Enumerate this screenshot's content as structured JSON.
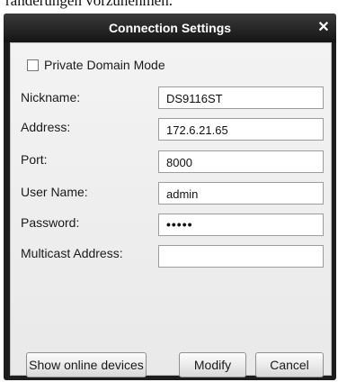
{
  "background": {
    "text": "ränderungen vorzunehmen."
  },
  "dialog": {
    "title": "Connection Settings",
    "close_glyph": "✕",
    "private_domain": {
      "label": "Private Domain Mode",
      "checked": false
    },
    "fields": [
      {
        "label": "Nickname:",
        "value": "DS9116ST"
      },
      {
        "label": "Address:",
        "value": "172.6.21.65"
      },
      {
        "label": "Port:",
        "value": "8000"
      },
      {
        "label": "User Name:",
        "value": "admin"
      },
      {
        "label": "Password:",
        "value": "•••••"
      },
      {
        "label": "Multicast Address:",
        "value": ""
      }
    ],
    "buttons": {
      "show_online": "Show online devices",
      "modify": "Modify",
      "cancel": "Cancel"
    }
  },
  "colors": {
    "window": "#1d1d1d",
    "panel": "#efefef"
  }
}
